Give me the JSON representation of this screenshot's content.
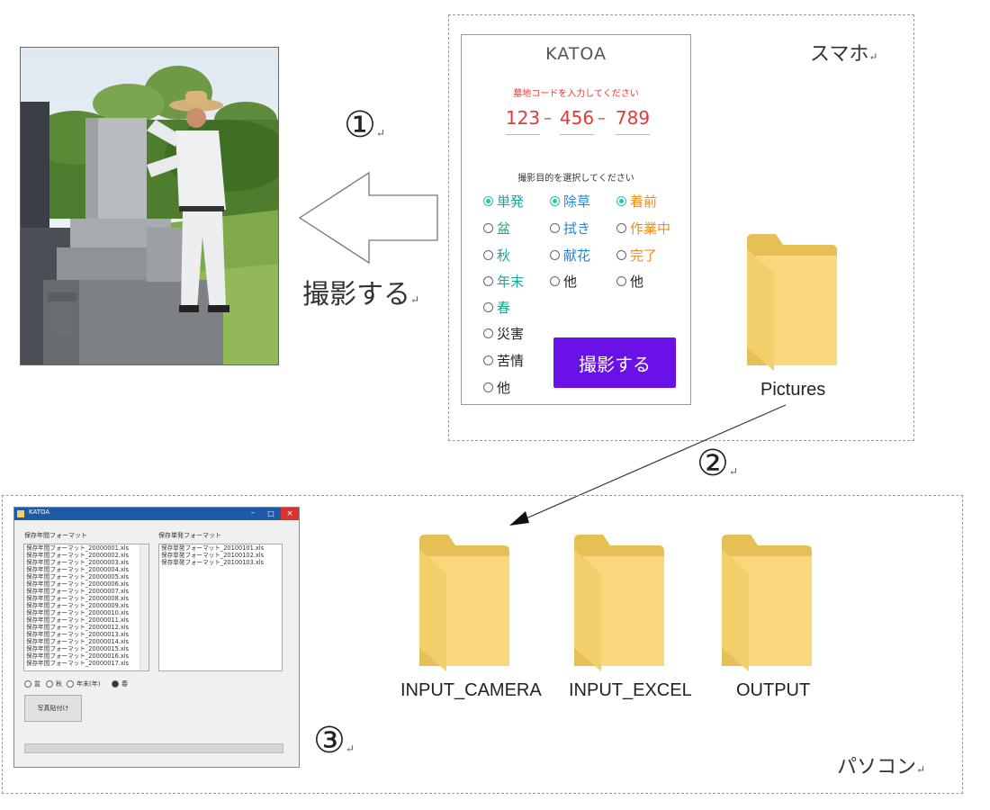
{
  "step1": {
    "number": "①",
    "caption": "撮影する"
  },
  "step2": {
    "number": "②"
  },
  "step3": {
    "number": "③"
  },
  "return_mark": "↵",
  "smartphone": {
    "region_label": "スマホ",
    "app": {
      "title": "KATOA",
      "code_prompt": "墓地コードを入力してください",
      "code_parts": [
        "123",
        "456",
        "789"
      ],
      "purpose_prompt": "撮影目的を選択してください",
      "groups": [
        {
          "color": "#1aa79a",
          "options": [
            {
              "label": "単発",
              "selected": true
            },
            {
              "label": "盆",
              "selected": false
            },
            {
              "label": "秋",
              "selected": false
            },
            {
              "label": "年末",
              "selected": false
            },
            {
              "label": "春",
              "selected": false
            }
          ]
        },
        {
          "color": "#222222",
          "options": [
            {
              "label": "災害",
              "selected": false
            },
            {
              "label": "苦情",
              "selected": false
            },
            {
              "label": "他",
              "selected": false
            }
          ]
        },
        {
          "color": "#1e88d6",
          "options": [
            {
              "label": "除草",
              "selected": true
            },
            {
              "label": "拭き",
              "selected": false
            },
            {
              "label": "献花",
              "selected": false
            },
            {
              "label": "他",
              "selected": false
            }
          ]
        },
        {
          "color": "#f28c1a",
          "options": [
            {
              "label": "着前",
              "selected": true
            },
            {
              "label": "作業中",
              "selected": false
            },
            {
              "label": "完了",
              "selected": false
            },
            {
              "label": "他",
              "selected": false
            }
          ]
        }
      ],
      "shoot_button": "撮影する"
    },
    "folder": "Pictures"
  },
  "pc": {
    "region_label": "パソコン",
    "folders": [
      "INPUT_CAMERA",
      "INPUT_EXCEL",
      "OUTPUT"
    ],
    "app": {
      "title": "KATOA",
      "list1_label": "保存年間フォーマット",
      "list1_items": [
        "保存年間フォーマット_20000001.xls",
        "保存年間フォーマット_20000002.xls",
        "保存年間フォーマット_20000003.xls",
        "保存年間フォーマット_20000004.xls",
        "保存年間フォーマット_20000005.xls",
        "保存年間フォーマット_20000006.xls",
        "保存年間フォーマット_20000007.xls",
        "保存年間フォーマット_20000008.xls",
        "保存年間フォーマット_20000009.xls",
        "保存年間フォーマット_20000010.xls",
        "保存年間フォーマット_20000011.xls",
        "保存年間フォーマット_20000012.xls",
        "保存年間フォーマット_20000013.xls",
        "保存年間フォーマット_20000014.xls",
        "保存年間フォーマット_20000015.xls",
        "保存年間フォーマット_20000016.xls",
        "保存年間フォーマット_20000017.xls"
      ],
      "list2_label": "保存単発フォーマット",
      "list2_items": [
        "保存単発フォーマット_20100101.xls",
        "保存単発フォーマット_20100102.xls",
        "保存単発フォーマット_20100103.xls"
      ],
      "radios": [
        {
          "label": "盆",
          "selected": false
        },
        {
          "label": "秋",
          "selected": false
        },
        {
          "label": "年末(年)",
          "selected": false
        },
        {
          "label": "春",
          "selected": true
        }
      ],
      "button": "写真貼付け",
      "progress": 0
    }
  }
}
